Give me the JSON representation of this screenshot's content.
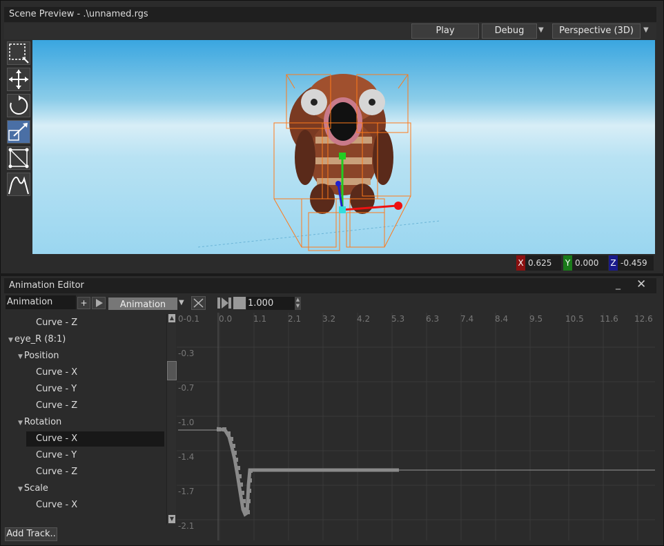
{
  "scene_preview": {
    "title": "Scene Preview - .\\unnamed.rgs",
    "play_label": "Play",
    "debug_label": "Debug",
    "view_mode": "Perspective (3D)",
    "coords": {
      "x_label": "X",
      "x": "0.625",
      "y_label": "Y",
      "y": "0.000",
      "z_label": "Z",
      "z": "-0.459"
    },
    "tools": [
      "select-region",
      "move",
      "rotate",
      "scale",
      "bounds",
      "curve"
    ]
  },
  "animation_editor": {
    "title": "Animation Editor",
    "animation_field": "Animation",
    "animation_select": "Animation",
    "speed": "1.000",
    "add_track_label": "Add Track..",
    "tree": [
      {
        "label": "Curve - Z",
        "level": 2,
        "selected": false
      },
      {
        "label": "eye_R (8:1)",
        "level": 0,
        "arrow": "▼",
        "selected": false
      },
      {
        "label": "Position",
        "level": 1,
        "arrow": "▼",
        "selected": false
      },
      {
        "label": "Curve - X",
        "level": 2,
        "selected": false
      },
      {
        "label": "Curve - Y",
        "level": 2,
        "selected": false
      },
      {
        "label": "Curve - Z",
        "level": 2,
        "selected": false
      },
      {
        "label": "Rotation",
        "level": 1,
        "arrow": "▼",
        "selected": false
      },
      {
        "label": "Curve - X",
        "level": 2,
        "selected": true
      },
      {
        "label": "Curve - Y",
        "level": 2,
        "selected": false
      },
      {
        "label": "Curve - Z",
        "level": 2,
        "selected": false
      },
      {
        "label": "Scale",
        "level": 1,
        "arrow": "▼",
        "selected": false
      },
      {
        "label": "Curve - X",
        "level": 2,
        "selected": false
      }
    ],
    "time_ruler": [
      "0-0.1",
      "0.0",
      "1.1",
      "2.1",
      "3.2",
      "4.2",
      "5.3",
      "6.3",
      "7.4",
      "8.4",
      "9.5",
      "10.5",
      "11.6",
      "12.6"
    ],
    "value_ruler": [
      "-0.3",
      "-0.7",
      "-1.0",
      "-1.4",
      "-1.7",
      "-2.1"
    ]
  }
}
